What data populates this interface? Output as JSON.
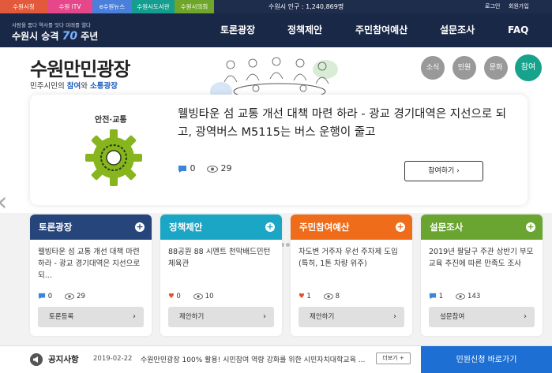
{
  "topbar": {
    "tabs": [
      {
        "label": "수원시청",
        "color": "#e3593b"
      },
      {
        "label": "수원 iTV",
        "color": "#e6478a"
      },
      {
        "label": "e수원뉴스",
        "color": "#4a7fdc"
      },
      {
        "label": "수원시도서관",
        "color": "#159e8f"
      },
      {
        "label": "수원시의회",
        "color": "#6fa52a"
      }
    ],
    "population": "수원시 인구 : 1,240,869명",
    "login": "로그인",
    "join": "회원가입"
  },
  "header": {
    "slogan": "사람을 품다 역사를 잇다 미래를 열다",
    "logo_prefix": "수원시 승격",
    "logo_number": "70",
    "logo_suffix": "주년",
    "nav": [
      "토론광장",
      "정책제안",
      "주민참여예산",
      "설문조사",
      "FAQ"
    ]
  },
  "hero": {
    "title": "수원만민광장",
    "subtitle_prefix": "민주시민의 ",
    "subtitle_em1": "참여",
    "subtitle_mid": "와 ",
    "subtitle_em2": "소통광장",
    "circles": [
      "소식",
      "민원",
      "문화",
      "참여"
    ],
    "active_circle": "참여"
  },
  "slide": {
    "category": "안전·교통",
    "headline": "웰빙타운 섬 교통 개선 대책 마련 하라 - 광교 경기대역은 지선으로 되고, 광역버스 M5115는 버스 운행이 줄고",
    "comments": "0",
    "views": "29",
    "button": "참여하기",
    "prev": "‹",
    "next": "›",
    "dot_count": 5,
    "active_dot": 0
  },
  "cards": [
    {
      "title": "토론광장",
      "color": "#26457b",
      "body": "웰빙타운 섬 교통 개선 대책 마련 하라 - 광교 경기대역은 지선으로 되...",
      "stat1_icon": "comment-icon",
      "stat1": "0",
      "stat2": "29",
      "button": "토론등록"
    },
    {
      "title": "정책제안",
      "color": "#1aa6c4",
      "body": "88공원 88 시멘트 천막배드민턴 체육관",
      "stat1_icon": "heart-icon",
      "stat1": "0",
      "stat2": "10",
      "button": "제안하기"
    },
    {
      "title": "주민참여예산",
      "color": "#ef6c1a",
      "body": "차도변 거주자 우선 주차제 도입(특히, 1톤 차량 위주)",
      "stat1_icon": "heart-icon",
      "stat1": "1",
      "stat2": "8",
      "button": "제안하기"
    },
    {
      "title": "설문조사",
      "color": "#6aa532",
      "body": "2019년 팔달구 주관 상반기 부모교육 추진에 따른 만족도 조사",
      "stat1_icon": "comment-icon",
      "stat1": "1",
      "stat2": "143",
      "button": "설문참여"
    }
  ],
  "notice": {
    "title": "공지사항",
    "date": "2019-02-22",
    "text": "수원만민광장 100% 활용! 시민참여 역량 강화를 위한 시민자치대학교육 ...",
    "more": "더보기",
    "apply": "민원신청 바로가기"
  },
  "colors": {
    "header_bg": "#1a2847",
    "accent_blue": "#1d6fd4",
    "active_circle": "#17a38b",
    "gear": "#86b51e"
  }
}
